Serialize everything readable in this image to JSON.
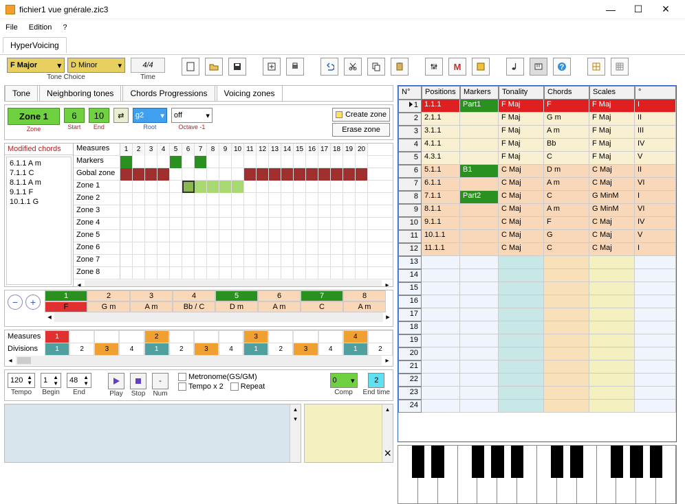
{
  "window": {
    "title": "fichier1 vue gnérale.zic3"
  },
  "menu": {
    "file": "File",
    "edition": "Edition",
    "help": "?"
  },
  "app_tab": "HyperVoicing",
  "toolbar": {
    "key1": "F Major",
    "key2": "D Minor",
    "tone_choice_label": "Tone Choice",
    "time_sig": "4/4",
    "time_label": "Time"
  },
  "subtabs": {
    "tone": "Tone",
    "neigh": "Neighboring tones",
    "prog": "Chords Progressions",
    "vz": "Voicing zones"
  },
  "zonebar": {
    "zone": "Zone 1",
    "zone_label": "Zone",
    "start": "6",
    "start_label": "Start",
    "end": "10",
    "end_label": "End",
    "root": "g2",
    "root_label": "Root",
    "octave": "off",
    "octave_label": "Octave -1",
    "create": "Create zone",
    "erase": "Erase zone"
  },
  "modchords": {
    "header": "Modified chords",
    "items": [
      "6.1.1 A m",
      "7.1.1 C",
      "8.1.1 A m",
      "9.1.1 F",
      "10.1.1 G"
    ]
  },
  "gridrows": [
    "Measures",
    "Markers",
    "Gobal zone",
    "Zone  1",
    "Zone  2",
    "Zone  3",
    "Zone  4",
    "Zone  5",
    "Zone  6",
    "Zone  7",
    "Zone  8"
  ],
  "measure_nums": [
    "1",
    "2",
    "3",
    "4",
    "5",
    "6",
    "7",
    "8",
    "9",
    "10",
    "11",
    "12",
    "13",
    "14",
    "15",
    "16",
    "17",
    "18",
    "19",
    "20"
  ],
  "chordstrip": {
    "nums": [
      "1",
      "2",
      "3",
      "4",
      "5",
      "6",
      "7",
      "8"
    ],
    "chords": [
      "F",
      "G m",
      "A m",
      "Bb / C",
      "D m",
      "A m",
      "C",
      "A m"
    ]
  },
  "divstrip": {
    "meas_label": "Measures",
    "div_label": "Divisions",
    "meas": [
      "1",
      "",
      "",
      "",
      "2",
      "",
      "",
      "",
      "3",
      "",
      "",
      "",
      "4",
      ""
    ],
    "div": [
      "1",
      "2",
      "3",
      "4",
      "1",
      "2",
      "3",
      "4",
      "1",
      "2",
      "3",
      "4",
      "1",
      "2"
    ]
  },
  "play": {
    "tempo": "120",
    "tempo_lbl": "Tempo",
    "begin": "1",
    "begin_lbl": "Begin",
    "end": "48",
    "end_lbl": "End",
    "play_lbl": "Play",
    "stop_lbl": "Stop",
    "num_lbl": "Num",
    "metro": "Metronome(GS/GM)",
    "tx2": "Tempo x 2",
    "repeat": "Repeat",
    "comp": "0",
    "comp_lbl": "Comp",
    "endtime": "2",
    "endtime_lbl": "End time"
  },
  "bigtable": {
    "headers": {
      "n": "N°",
      "p": "Positions",
      "m": "Markers",
      "t": "Tonality",
      "c": "Chords",
      "s": "Scales",
      "d": "°"
    },
    "rows": [
      {
        "n": 1,
        "p": "1.1.1",
        "m": "Part1",
        "t": "F Maj",
        "c": "F",
        "s": "F Maj",
        "d": "I",
        "cls": "row-sel"
      },
      {
        "n": 2,
        "p": "2.1.1",
        "m": "",
        "t": "F Maj",
        "c": "G m",
        "s": "F Maj",
        "d": "II",
        "cls": "row-cream"
      },
      {
        "n": 3,
        "p": "3.1.1",
        "m": "",
        "t": "F Maj",
        "c": "A m",
        "s": "F Maj",
        "d": "III",
        "cls": "row-cream"
      },
      {
        "n": 4,
        "p": "4.1.1",
        "m": "",
        "t": "F Maj",
        "c": "Bb",
        "s": "F Maj",
        "d": "IV",
        "cls": "row-cream"
      },
      {
        "n": 5,
        "p": "4.3.1",
        "m": "",
        "t": "F Maj",
        "c": "C",
        "s": "F Maj",
        "d": "V",
        "cls": "row-cream"
      },
      {
        "n": 6,
        "p": "5.1.1",
        "m": "B1",
        "t": "C Maj",
        "c": "D m",
        "s": "C Maj",
        "d": "II",
        "cls": "row-peach",
        "mk": true
      },
      {
        "n": 7,
        "p": "6.1.1",
        "m": "",
        "t": "C Maj",
        "c": "A m",
        "s": "C Maj",
        "d": "VI",
        "cls": "row-peach"
      },
      {
        "n": 8,
        "p": "7.1.1",
        "m": "Part2",
        "t": "C Maj",
        "c": "C",
        "s": "G MinM",
        "d": "I",
        "cls": "row-peach",
        "mk": true
      },
      {
        "n": 9,
        "p": "8.1.1",
        "m": "",
        "t": "C Maj",
        "c": "A m",
        "s": "G MinM",
        "d": "VI",
        "cls": "row-peach"
      },
      {
        "n": 10,
        "p": "9.1.1",
        "m": "",
        "t": "C Maj",
        "c": "F",
        "s": "C Maj",
        "d": "IV",
        "cls": "row-peach"
      },
      {
        "n": 11,
        "p": "10.1.1",
        "m": "",
        "t": "C Maj",
        "c": "G",
        "s": "C Maj",
        "d": "V",
        "cls": "row-peach"
      },
      {
        "n": 12,
        "p": "11.1.1",
        "m": "",
        "t": "C Maj",
        "c": "C",
        "s": "C Maj",
        "d": "I",
        "cls": "row-peach"
      },
      {
        "n": 13,
        "cls": "row-empty"
      },
      {
        "n": 14,
        "cls": "row-empty"
      },
      {
        "n": 15,
        "cls": "row-empty"
      },
      {
        "n": 16,
        "cls": "row-empty"
      },
      {
        "n": 17,
        "cls": "row-empty"
      },
      {
        "n": 18,
        "cls": "row-empty"
      },
      {
        "n": 19,
        "cls": "row-empty"
      },
      {
        "n": 20,
        "cls": "row-empty"
      },
      {
        "n": 21,
        "cls": "row-empty"
      },
      {
        "n": 22,
        "cls": "row-empty"
      },
      {
        "n": 23,
        "cls": "row-empty"
      },
      {
        "n": 24,
        "cls": "row-empty"
      }
    ]
  }
}
